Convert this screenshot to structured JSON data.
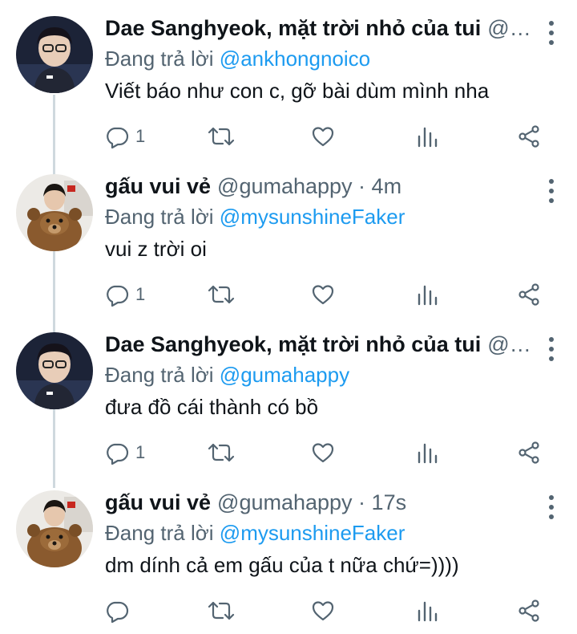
{
  "replying_prefix": "Đang trả lời",
  "colors": {
    "link": "#1d9bf0",
    "secondary": "#536471",
    "text": "#0f1419",
    "thread": "#cfd9de"
  },
  "tweets": [
    {
      "author": "Dae Sanghyeok, mặt trời nhỏ của tui",
      "meta": "@…",
      "replying_to": "@ankhongnoico",
      "text": "Viết báo như con c, gỡ bài dùm mình nha",
      "reply_count": "1",
      "avatar": "faker-avatar"
    },
    {
      "author": "gấu vui vẻ",
      "meta": "@gumahappy · 4m",
      "replying_to": "@mysunshineFaker",
      "text": "vui z trời oi",
      "reply_count": "1",
      "avatar": "bear-avatar"
    },
    {
      "author": "Dae Sanghyeok, mặt trời nhỏ của tui",
      "meta": "@…",
      "replying_to": "@gumahappy",
      "text": "đưa đồ cái thành có bồ",
      "reply_count": "1",
      "avatar": "faker-avatar"
    },
    {
      "author": "gấu vui vẻ",
      "meta": "@gumahappy · 17s",
      "replying_to": "@mysunshineFaker",
      "text": "dm dính cả em gấu của t nữa chứ=))))",
      "reply_count": "",
      "avatar": "bear-avatar"
    }
  ]
}
